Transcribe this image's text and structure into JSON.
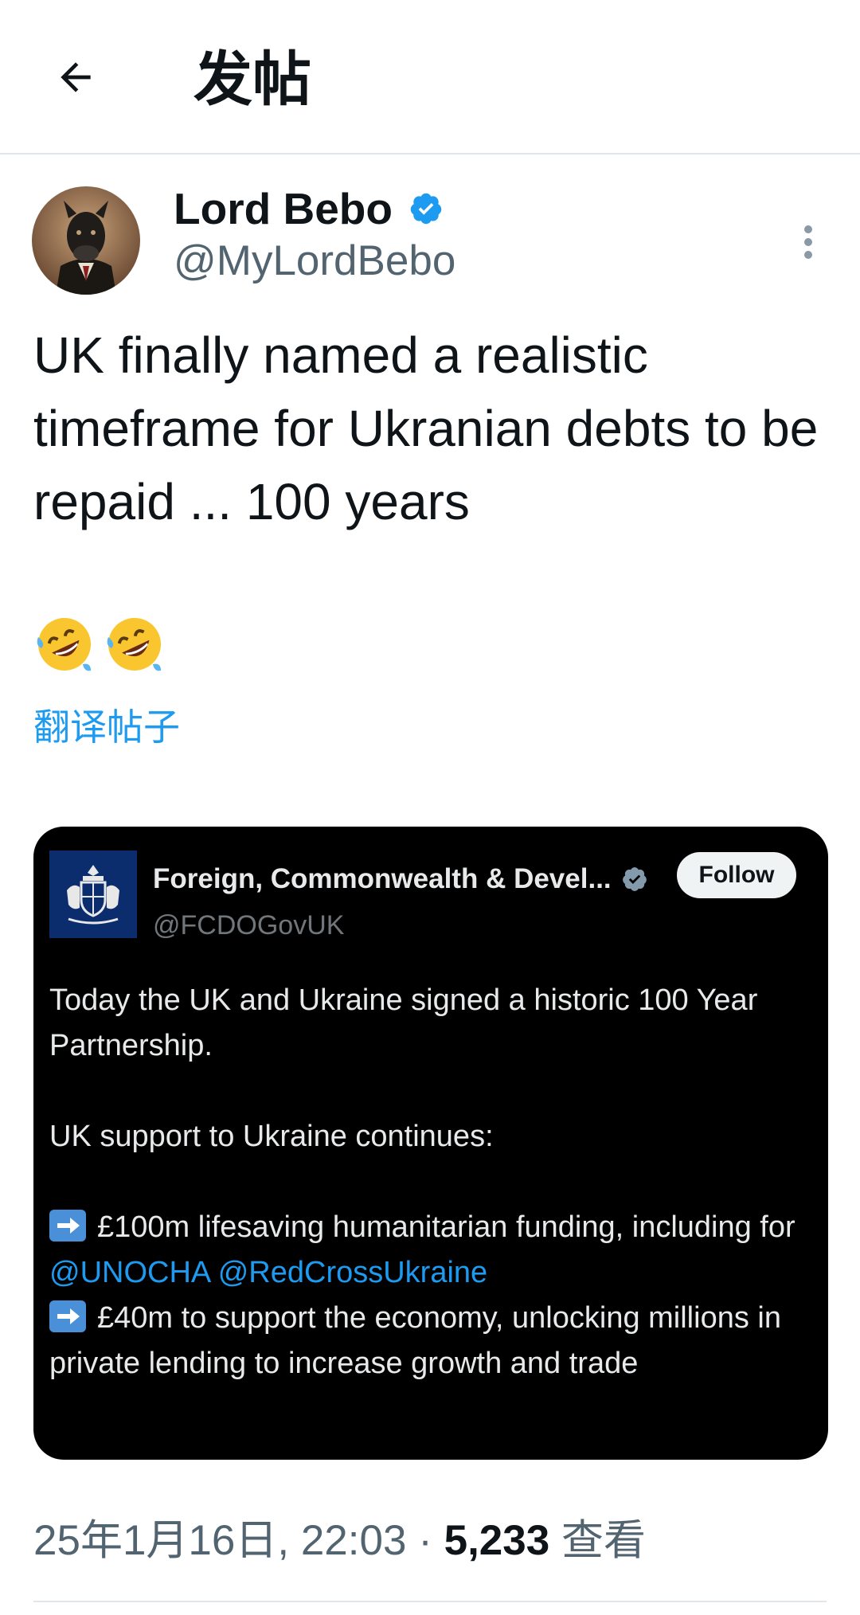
{
  "header": {
    "title": "发帖",
    "back_icon": "arrow-left-icon"
  },
  "author": {
    "display_name": "Lord Bebo",
    "handle": "@MyLordBebo",
    "verified_icon": "verified-badge-icon",
    "verified_color": "#1d9bf0"
  },
  "tweet": {
    "text": "UK finally named a realistic timeframe for Ukranian debts to be repaid ... 100 years",
    "emojis": "🤣🤣",
    "translate_label": "翻译帖子"
  },
  "quote": {
    "display_name": "Foreign, Commonwealth & Devel...",
    "handle": "@FCDOGovUK",
    "follow_label": "Follow",
    "paragraph_1": "Today the UK and Ukraine signed a historic 100 Year Partnership.",
    "paragraph_2": "UK support to Ukraine continues:",
    "item_1_text": "£100m lifesaving humanitarian funding, including for",
    "mention_1": "@UNOCHA",
    "mention_2": "@RedCrossUkraine",
    "item_2_text": "£40m to support the economy, unlocking millions in private lending to increase growth and trade",
    "bullet_icon": "right-arrow-emoji-icon"
  },
  "meta": {
    "timestamp": "25年1月16日, 22:03",
    "separator": "·",
    "views_count": "5,233",
    "views_label": "查看"
  },
  "colors": {
    "accent": "#1d9bf0",
    "secondary_text": "#536471",
    "card_bg": "#000000"
  }
}
